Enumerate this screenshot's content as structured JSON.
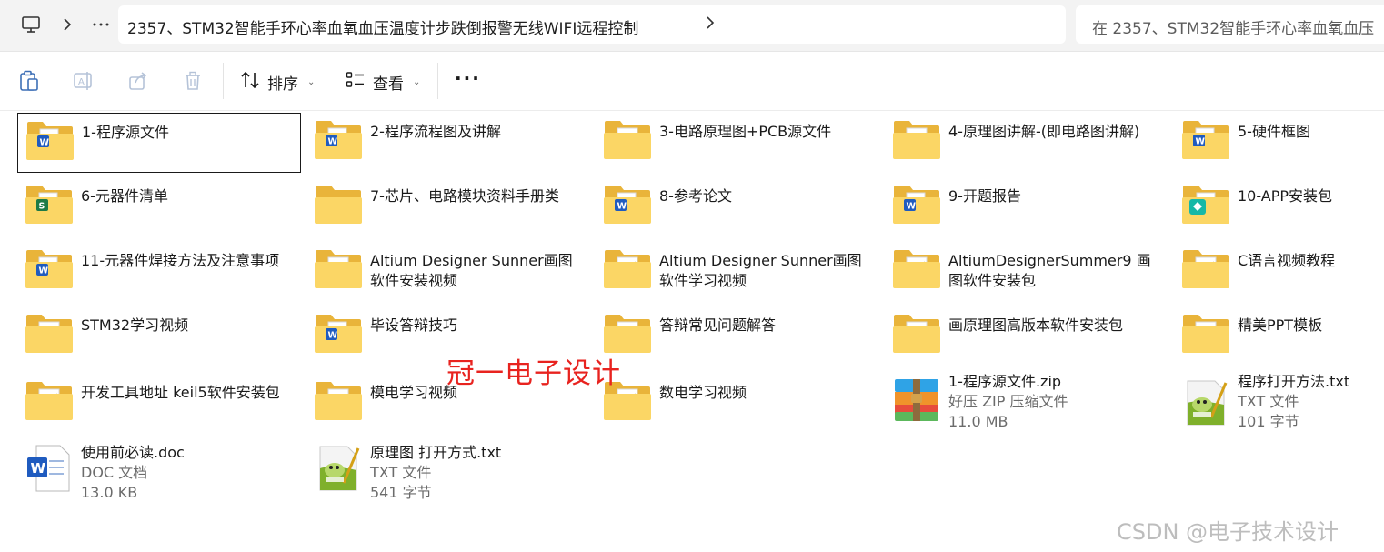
{
  "address": {
    "path": "2357、STM32智能手环心率血氧血压温度计步跌倒报警无线WIFI远程控制",
    "search_placeholder": "在 2357、STM32智能手环心率血氧血压"
  },
  "toolbar": {
    "sort_label": "排序",
    "view_label": "查看"
  },
  "items": [
    {
      "name": "1-程序源文件",
      "type": "folder",
      "badge": "word"
    },
    {
      "name": "2-程序流程图及讲解",
      "type": "folder",
      "badge": "word"
    },
    {
      "name": "3-电路原理图+PCB源文件",
      "type": "folder",
      "badge": "doc"
    },
    {
      "name": "4-原理图讲解-(即电路图讲解)",
      "type": "folder",
      "badge": "doc"
    },
    {
      "name": "5-硬件框图",
      "type": "folder",
      "badge": "word"
    },
    {
      "name": "6-元器件清单",
      "type": "folder",
      "badge": "excel"
    },
    {
      "name": "7-芯片、电路模块资料手册类",
      "type": "folder",
      "badge": "none"
    },
    {
      "name": "8-参考论文",
      "type": "folder",
      "badge": "word"
    },
    {
      "name": "9-开题报告",
      "type": "folder",
      "badge": "word"
    },
    {
      "name": "10-APP安装包",
      "type": "folder",
      "badge": "app"
    },
    {
      "name": "11-元器件焊接方法及注意事项",
      "type": "folder",
      "badge": "word"
    },
    {
      "name": "Altium Designer Sunner画图软件安装视频",
      "type": "folder",
      "badge": "video"
    },
    {
      "name": "Altium Designer Sunner画图软件学习视频",
      "type": "folder",
      "badge": "video"
    },
    {
      "name": "AltiumDesignerSummer9 画图软件安装包",
      "type": "folder",
      "badge": "video"
    },
    {
      "name": "C语言视频教程",
      "type": "folder",
      "badge": "video"
    },
    {
      "name": "STM32学习视频",
      "type": "folder",
      "badge": "video"
    },
    {
      "name": "毕设答辩技巧",
      "type": "folder",
      "badge": "word"
    },
    {
      "name": "答辩常见问题解答",
      "type": "folder",
      "badge": "doc"
    },
    {
      "name": "画原理图高版本软件安装包",
      "type": "folder",
      "badge": "video"
    },
    {
      "name": "精美PPT模板",
      "type": "folder",
      "badge": "video"
    },
    {
      "name": "开发工具地址 keil5软件安装包",
      "type": "folder",
      "badge": "video"
    },
    {
      "name": "模电学习视频",
      "type": "folder",
      "badge": "video"
    },
    {
      "name": "数电学习视频",
      "type": "folder",
      "badge": "video"
    },
    {
      "name": "1-程序源文件.zip",
      "type": "zip",
      "desc": "好压 ZIP 压缩文件",
      "size": "11.0 MB"
    },
    {
      "name": "程序打开方法.txt",
      "type": "txt",
      "desc": "TXT 文件",
      "size": "101 字节"
    },
    {
      "name": "使用前必读.doc",
      "type": "wordfile",
      "desc": "DOC 文档",
      "size": "13.0 KB"
    },
    {
      "name": "原理图 打开方式.txt",
      "type": "txt",
      "desc": "TXT 文件",
      "size": "541 字节"
    }
  ],
  "overlay_text": "冠一电子设计",
  "csdn_watermark": "CSDN @电子技术设计",
  "colors": {
    "folder_back": "#e9b43a",
    "folder_front": "#fbd665",
    "word_blue": "#1f5bbf",
    "excel_green": "#1e7a46",
    "app_teal": "#16b8a6",
    "watermark_red": "#e8231f"
  }
}
